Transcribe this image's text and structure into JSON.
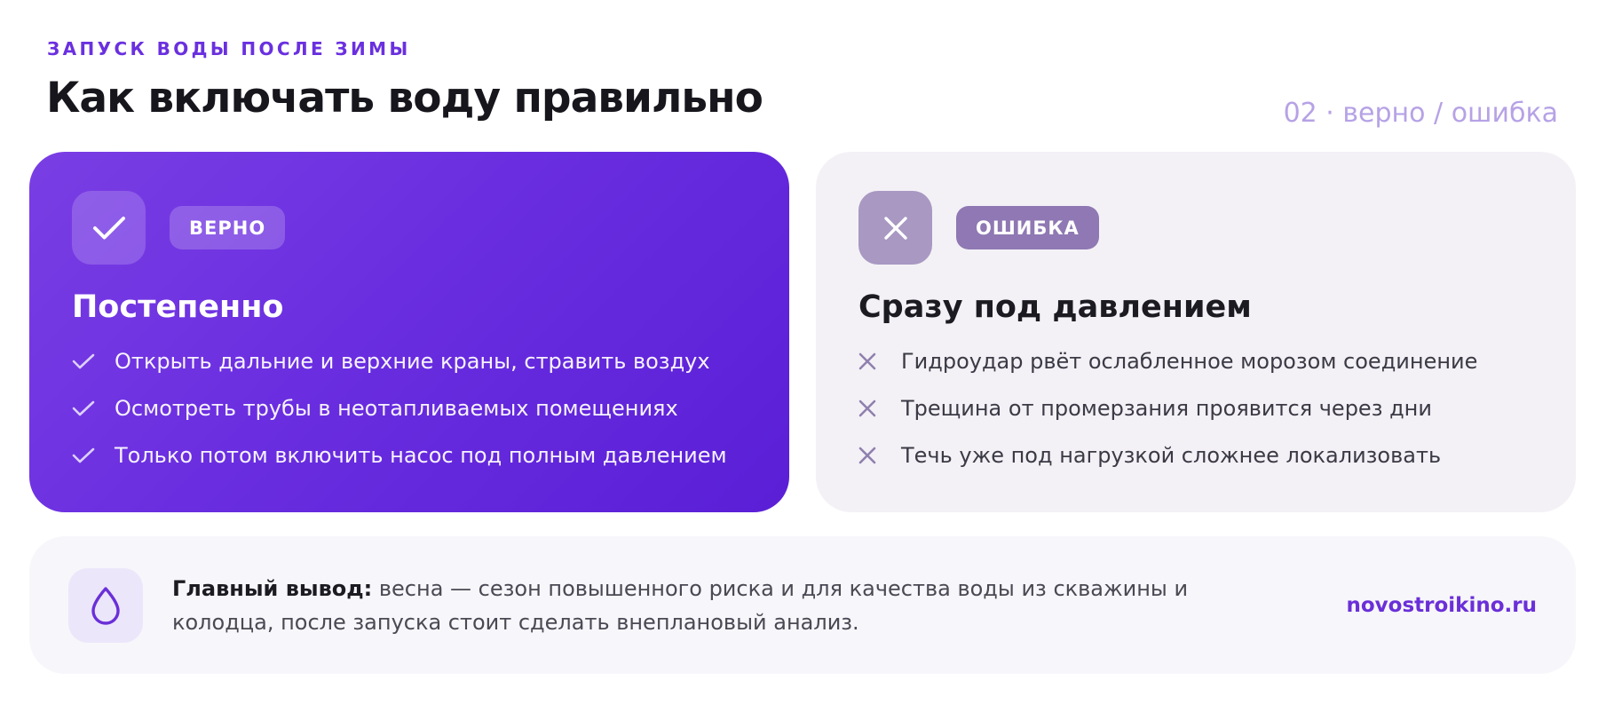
{
  "header": {
    "eyebrow": "ЗАПУСК ВОДЫ ПОСЛЕ ЗИМЫ",
    "title": "Как включать воду правильно",
    "counter": "02 · верно / ошибка"
  },
  "right_card": {
    "icon": "check-icon",
    "badge": "ВЕРНО",
    "title": "Постепенно",
    "items": [
      "Открыть дальние и верхние краны, стравить воздух",
      "Осмотреть трубы в неотапливаемых помещениях",
      "Только потом включить насос под полным давлением"
    ],
    "color": "#6a2ee0"
  },
  "wrong_card": {
    "icon": "close-icon",
    "badge": "ОШИБКА",
    "title": "Сразу под давлением",
    "items": [
      "Гидроудар рвёт ослабленное морозом соединение",
      "Трещина от промерзания проявится через дни",
      "Течь уже под нагрузкой сложнее локализовать"
    ],
    "color": "#f3f1f6"
  },
  "summary": {
    "icon": "water-drop-icon",
    "lead": "Главный вывод:",
    "text": " весна — сезон повышенного риска и для качества воды из скважины и колодца, после запуска стоит сделать внеплановый анализ.",
    "site": "novostroikino.ru"
  }
}
